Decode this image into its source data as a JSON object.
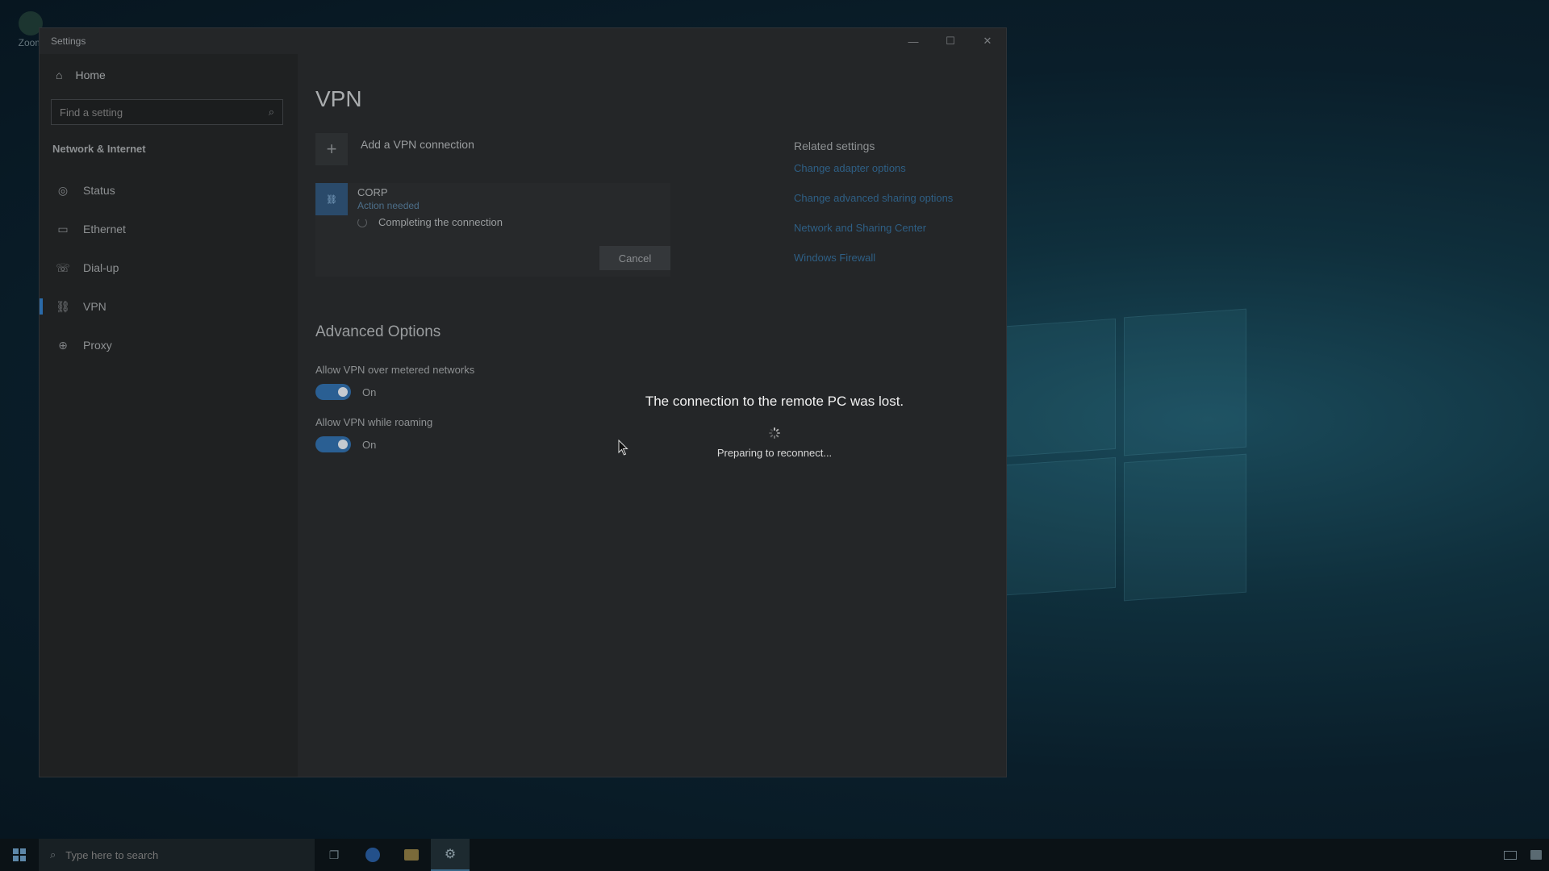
{
  "desktop": {
    "icon_label": "Zoom"
  },
  "window": {
    "title": "Settings",
    "controls": {
      "minimize": "—",
      "maximize": "☐",
      "close": "✕"
    }
  },
  "sidebar": {
    "home_label": "Home",
    "search_placeholder": "Find a setting",
    "section_title": "Network & Internet",
    "items": [
      {
        "label": "Status",
        "icon": "status-icon",
        "glyph": "◎"
      },
      {
        "label": "Ethernet",
        "icon": "ethernet-icon",
        "glyph": "▭"
      },
      {
        "label": "Dial-up",
        "icon": "dialup-icon",
        "glyph": "☏"
      },
      {
        "label": "VPN",
        "icon": "vpn-icon",
        "glyph": "⛓"
      },
      {
        "label": "Proxy",
        "icon": "proxy-icon",
        "glyph": "⊕"
      }
    ],
    "active_index": 3
  },
  "content": {
    "title": "VPN",
    "add_connection_label": "Add a VPN connection",
    "vpn": {
      "name": "CORP",
      "status": "Action needed",
      "progress_text": "Completing the connection",
      "cancel_label": "Cancel"
    },
    "advanced_title": "Advanced Options",
    "options": [
      {
        "label": "Allow VPN over metered networks",
        "state": "On"
      },
      {
        "label": "Allow VPN while roaming",
        "state": "On"
      }
    ]
  },
  "related": {
    "title": "Related settings",
    "links": [
      "Change adapter options",
      "Change advanced sharing options",
      "Network and Sharing Center",
      "Windows Firewall"
    ]
  },
  "overlay": {
    "message": "The connection to the remote PC was lost.",
    "status": "Preparing to reconnect..."
  },
  "taskbar": {
    "search_placeholder": "Type here to search"
  },
  "colors": {
    "accent": "#2a5f93",
    "link": "#2e5f85",
    "overlay_text": "#f2f2f2"
  }
}
